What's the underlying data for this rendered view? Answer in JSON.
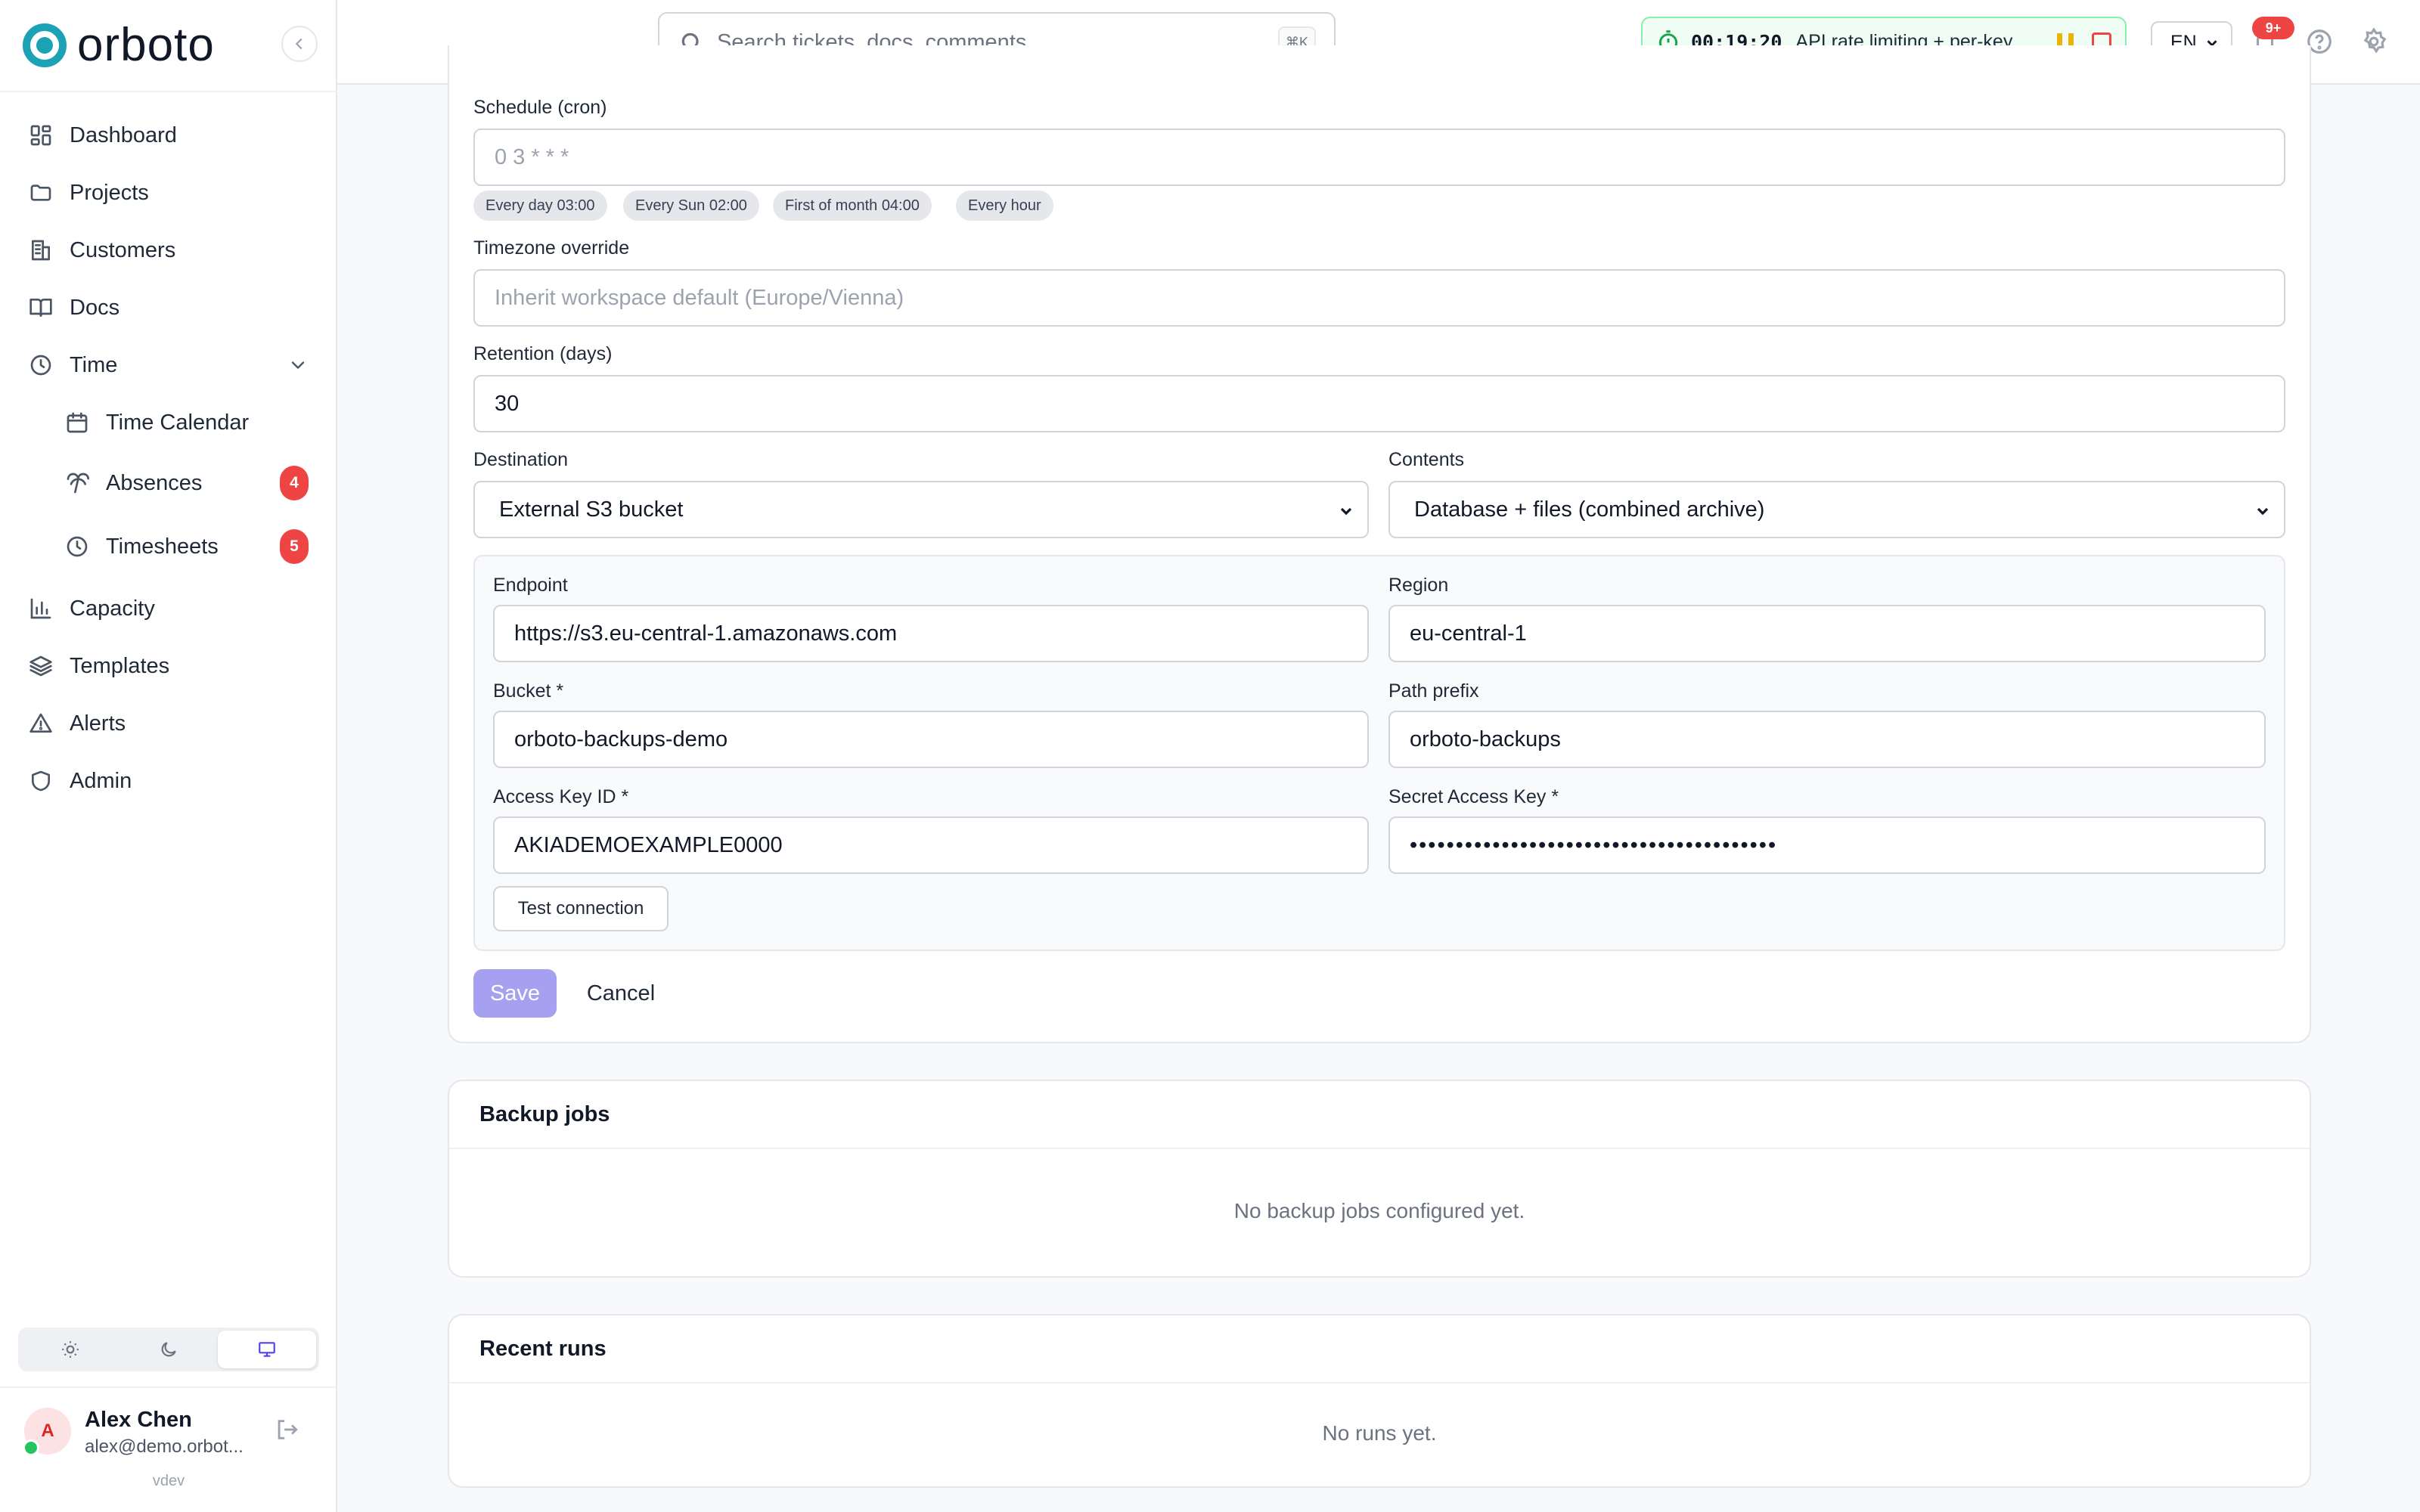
{
  "app": {
    "name": "orboto",
    "version": "vdev"
  },
  "colors": {
    "brand": "#1ba2b4",
    "accent": "#4f46e5",
    "danger": "#ef4444",
    "success": "#22c55e"
  },
  "sidebar": {
    "items": [
      {
        "label": "Dashboard",
        "icon": "dashboard-icon"
      },
      {
        "label": "Projects",
        "icon": "folder-icon"
      },
      {
        "label": "Customers",
        "icon": "building-icon"
      },
      {
        "label": "Docs",
        "icon": "book-icon"
      },
      {
        "label": "Time",
        "icon": "clock-icon",
        "expanded": true
      },
      {
        "label": "Time Calendar",
        "icon": "calendar-icon"
      },
      {
        "label": "Absences",
        "icon": "palm-tree-icon",
        "badge": "4"
      },
      {
        "label": "Timesheets",
        "icon": "clock-icon",
        "badge": "5"
      },
      {
        "label": "Capacity",
        "icon": "bar-chart-icon"
      },
      {
        "label": "Templates",
        "icon": "layers-icon"
      },
      {
        "label": "Alerts",
        "icon": "alert-triangle-icon"
      },
      {
        "label": "Admin",
        "icon": "shield-icon"
      }
    ],
    "theme": {
      "options": [
        "light",
        "dark",
        "system"
      ],
      "selected": "system"
    },
    "user": {
      "initial": "A",
      "name": "Alex Chen",
      "email": "alex@demo.orbot...",
      "status": "online"
    }
  },
  "topbar": {
    "search_placeholder": "Search tickets, docs, comments...",
    "search_shortcut": "⌘K",
    "timer": {
      "time": "00:19:20",
      "task": "API rate limiting + per-key ..."
    },
    "language": "EN",
    "notifications_badge": "9+"
  },
  "form": {
    "schedule": {
      "label": "Schedule (cron)",
      "placeholder": "0 3 * * *"
    },
    "presets": [
      "Every day 03:00",
      "Every Sun 02:00",
      "First of month 04:00",
      "Every hour"
    ],
    "timezone": {
      "label": "Timezone override",
      "placeholder": "Inherit workspace default (Europe/Vienna)"
    },
    "retention": {
      "label": "Retention (days)",
      "value": "30"
    },
    "destination": {
      "label": "Destination",
      "value": "External S3 bucket"
    },
    "contents": {
      "label": "Contents",
      "value": "Database + files (combined archive)"
    },
    "s3": {
      "endpoint": {
        "label": "Endpoint",
        "value": "https://s3.eu-central-1.amazonaws.com"
      },
      "region": {
        "label": "Region",
        "value": "eu-central-1"
      },
      "bucket": {
        "label": "Bucket *",
        "value": "orboto-backups-demo"
      },
      "path_prefix": {
        "label": "Path prefix",
        "value": "orboto-backups"
      },
      "access_key": {
        "label": "Access Key ID *",
        "value": "AKIADEMOEXAMPLE0000"
      },
      "secret_key": {
        "label": "Secret Access Key *",
        "value": "••••••••••••••••••••••••••••••••••••••••"
      },
      "test_button": "Test connection"
    },
    "save_label": "Save",
    "cancel_label": "Cancel"
  },
  "jobs": {
    "title": "Backup jobs",
    "empty": "No backup jobs configured yet."
  },
  "runs": {
    "title": "Recent runs",
    "empty": "No runs yet."
  }
}
